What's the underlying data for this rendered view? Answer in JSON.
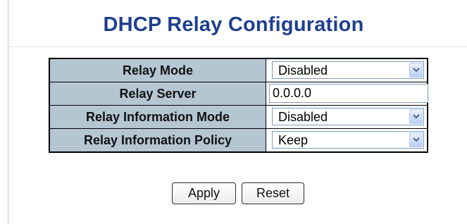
{
  "page": {
    "title": "DHCP Relay Configuration"
  },
  "form": {
    "rows": [
      {
        "label": "Relay Mode",
        "type": "select",
        "value": "Disabled"
      },
      {
        "label": "Relay Server",
        "type": "text",
        "value": "0.0.0.0"
      },
      {
        "label": "Relay Information Mode",
        "type": "select",
        "value": "Disabled"
      },
      {
        "label": "Relay Information Policy",
        "type": "select",
        "value": "Keep"
      }
    ]
  },
  "buttons": {
    "apply": "Apply",
    "reset": "Reset"
  },
  "icons": {
    "dropdown": "chevron-down-icon"
  },
  "colors": {
    "title": "#1f3f8f",
    "label_background": "#b5c6d3",
    "field_border": "#7f9db9"
  }
}
